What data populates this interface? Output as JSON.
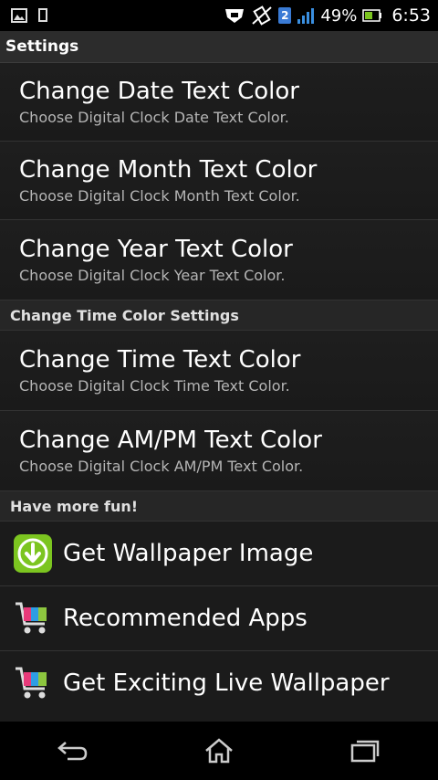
{
  "status_bar": {
    "sim_slot": "2",
    "battery_percent": "49%",
    "time": "6:53"
  },
  "header": {
    "title": "Settings"
  },
  "date_group": {
    "items": [
      {
        "title": "Change Date Text Color",
        "summary": "Choose Digital Clock Date Text Color."
      },
      {
        "title": "Change Month Text Color",
        "summary": "Choose Digital Clock Month Text Color."
      },
      {
        "title": "Change Year Text Color",
        "summary": "Choose Digital Clock Year Text Color."
      }
    ]
  },
  "time_group": {
    "header": "Change Time Color Settings",
    "items": [
      {
        "title": "Change Time Text Color",
        "summary": "Choose Digital Clock Time Text Color."
      },
      {
        "title": "Change AM/PM Text Color",
        "summary": "Choose Digital Clock AM/PM Text Color."
      }
    ]
  },
  "fun_group": {
    "header": "Have more fun!",
    "items": [
      {
        "label": "Get Wallpaper Image",
        "icon": "download-icon"
      },
      {
        "label": "Recommended Apps",
        "icon": "cart-icon"
      },
      {
        "label": "Get Exciting Live Wallpaper",
        "icon": "cart-icon"
      }
    ]
  },
  "nav": [
    "back-icon",
    "home-icon",
    "recent-apps-icon"
  ],
  "colors": {
    "accent_green": "#7cc520",
    "background": "#1a1a1a"
  }
}
